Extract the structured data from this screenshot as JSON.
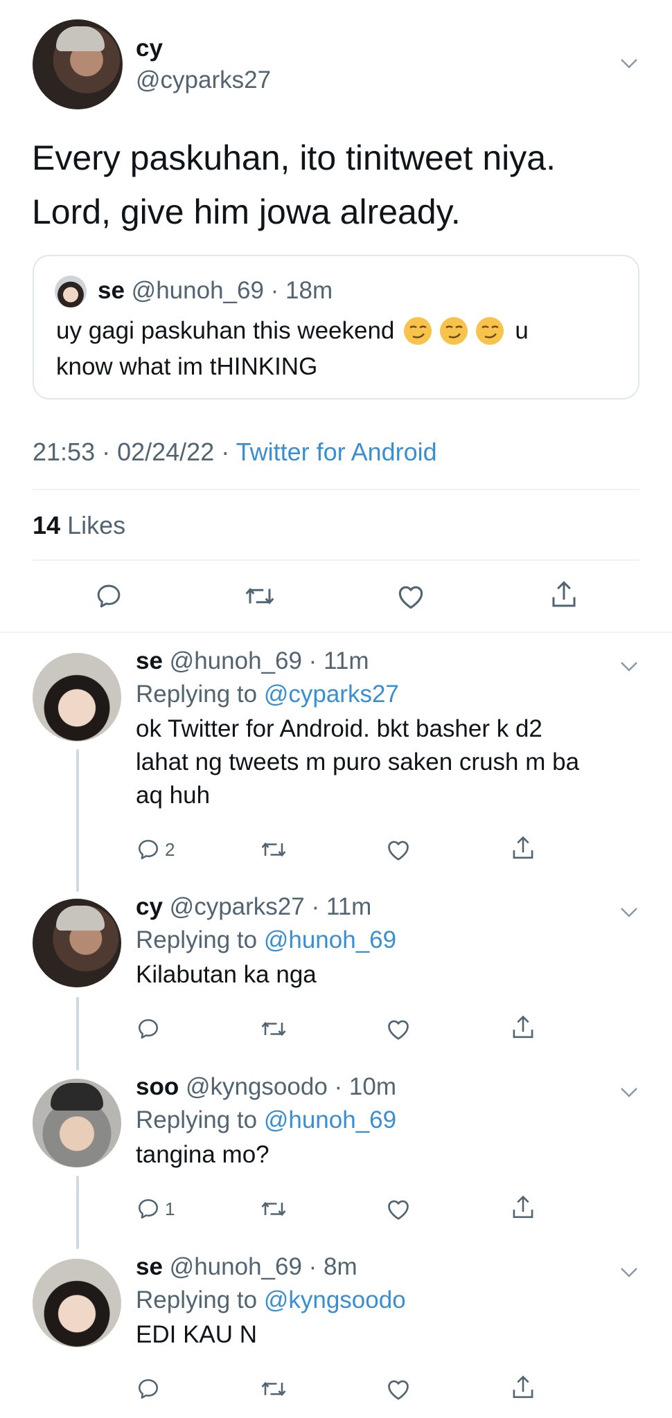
{
  "main_tweet": {
    "name": "cy",
    "handle": "@cyparks27",
    "text_line1": "Every paskuhan, ito tinitweet niya.",
    "text_line2": "Lord, give him jowa already.",
    "quote": {
      "name": "se",
      "handle": "@hunoh_69",
      "time": "18m",
      "text_before": "uy gagi paskuhan this weekend",
      "text_after": "u",
      "text_line2": "know what im tHINKING"
    },
    "timestamp": "21:53 · 02/24/22 ·",
    "source": "Twitter for Android",
    "likes_count": "14",
    "likes_label": "Likes"
  },
  "replies": [
    {
      "name": "se",
      "handle": "@hunoh_69",
      "time": "11m",
      "replying_label": "Replying to",
      "replying_to": "@cyparks27",
      "lines": [
        "ok Twitter for Android. bkt basher k d2",
        "lahat ng tweets m puro saken crush m ba",
        "aq huh"
      ],
      "reply_count": "2"
    },
    {
      "name": "cy",
      "handle": "@cyparks27",
      "time": "11m",
      "replying_label": "Replying to",
      "replying_to": "@hunoh_69",
      "lines": [
        "Kilabutan ka nga"
      ],
      "reply_count": ""
    },
    {
      "name": "soo",
      "handle": "@kyngsoodo",
      "time": "10m",
      "replying_label": "Replying to",
      "replying_to": "@hunoh_69",
      "lines": [
        "tangina mo?"
      ],
      "reply_count": "1"
    },
    {
      "name": "se",
      "handle": "@hunoh_69",
      "time": "8m",
      "replying_label": "Replying to",
      "replying_to": "@kyngsoodo",
      "lines": [
        "EDI KAU N"
      ],
      "reply_count": ""
    }
  ],
  "icons": [
    "chevron-down-icon",
    "reply-icon",
    "retweet-icon",
    "like-icon",
    "share-icon",
    "smirk-emoji"
  ],
  "colors": {
    "link": "#3b8ed0",
    "muted": "#536471",
    "text": "#0f1419",
    "divider": "#eff3f4"
  }
}
